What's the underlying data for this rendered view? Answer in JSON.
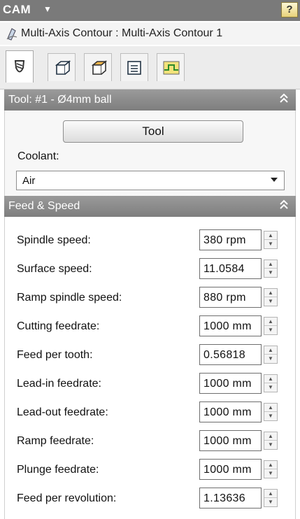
{
  "titlebar": {
    "title": "CAM",
    "caret": "▼",
    "help": "?"
  },
  "operation": {
    "label": "Multi-Axis Contour : Multi-Axis Contour 1",
    "icon": "toolpath-icon"
  },
  "tabs": [
    {
      "icon": "tool-tab-icon",
      "active": true
    },
    {
      "icon": "geometry-tab-icon",
      "active": false
    },
    {
      "icon": "heights-tab-icon",
      "active": false
    },
    {
      "icon": "passes-tab-icon",
      "active": false
    },
    {
      "icon": "linking-tab-icon",
      "active": false
    }
  ],
  "tool_section": {
    "header": "Tool: #1 - Ø4mm ball",
    "collapse_glyph": "⌃",
    "tool_button": "Tool",
    "coolant_label": "Coolant:",
    "coolant_value": "Air"
  },
  "feed_section": {
    "header": "Feed & Speed",
    "collapse_glyph": "⌃",
    "rows": [
      {
        "label": "Spindle speed:",
        "value": "380 rpm"
      },
      {
        "label": "Surface speed:",
        "value": "11.0584"
      },
      {
        "label": "Ramp spindle speed:",
        "value": "880 rpm"
      },
      {
        "label": "Cutting feedrate:",
        "value": "1000 mm"
      },
      {
        "label": "Feed per tooth:",
        "value": "0.56818"
      },
      {
        "label": "Lead-in feedrate:",
        "value": "1000 mm"
      },
      {
        "label": "Lead-out feedrate:",
        "value": "1000 mm"
      },
      {
        "label": "Ramp feedrate:",
        "value": "1000 mm"
      },
      {
        "label": "Plunge feedrate:",
        "value": "1000 mm"
      },
      {
        "label": "Feed per revolution:",
        "value": "1.13636"
      }
    ]
  }
}
